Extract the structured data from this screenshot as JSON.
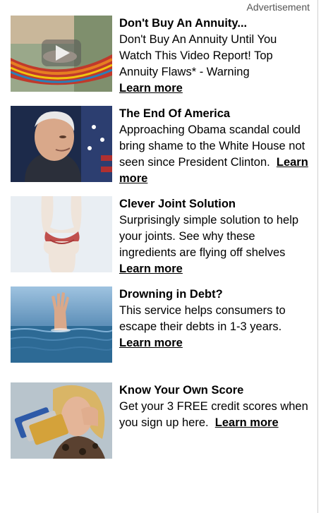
{
  "header": {
    "advertisement_label": "Advertisement"
  },
  "ads": [
    {
      "title": "Don't Buy An Annuity...",
      "description": "Don't Buy An Annuity Until You Watch This Video Report! Top Annuity Flaws* - Warning",
      "link_label": "Learn more",
      "image": "hammock-video-thumbnail"
    },
    {
      "title": "The End Of America",
      "description": "Approaching Obama scandal could bring shame to the White House not seen since President Clinton.",
      "link_label": "Learn more",
      "image": "politician-portrait"
    },
    {
      "title": "Clever Joint Solution",
      "description": "Surprisingly simple solution to help your joints. See why these ingredients are flying off shelves",
      "link_label": "Learn more",
      "image": "knee-joint-illustration"
    },
    {
      "title": "Drowning in Debt?",
      "description": "This service helps consumers to escape their debts in 1-3 years.",
      "link_label": "Learn more",
      "image": "hand-above-water"
    },
    {
      "title": "Know Your Own Score",
      "description": "Get your 3 FREE credit scores when you sign up here.",
      "link_label": "Learn more",
      "image": "woman-with-credit-cards"
    }
  ]
}
